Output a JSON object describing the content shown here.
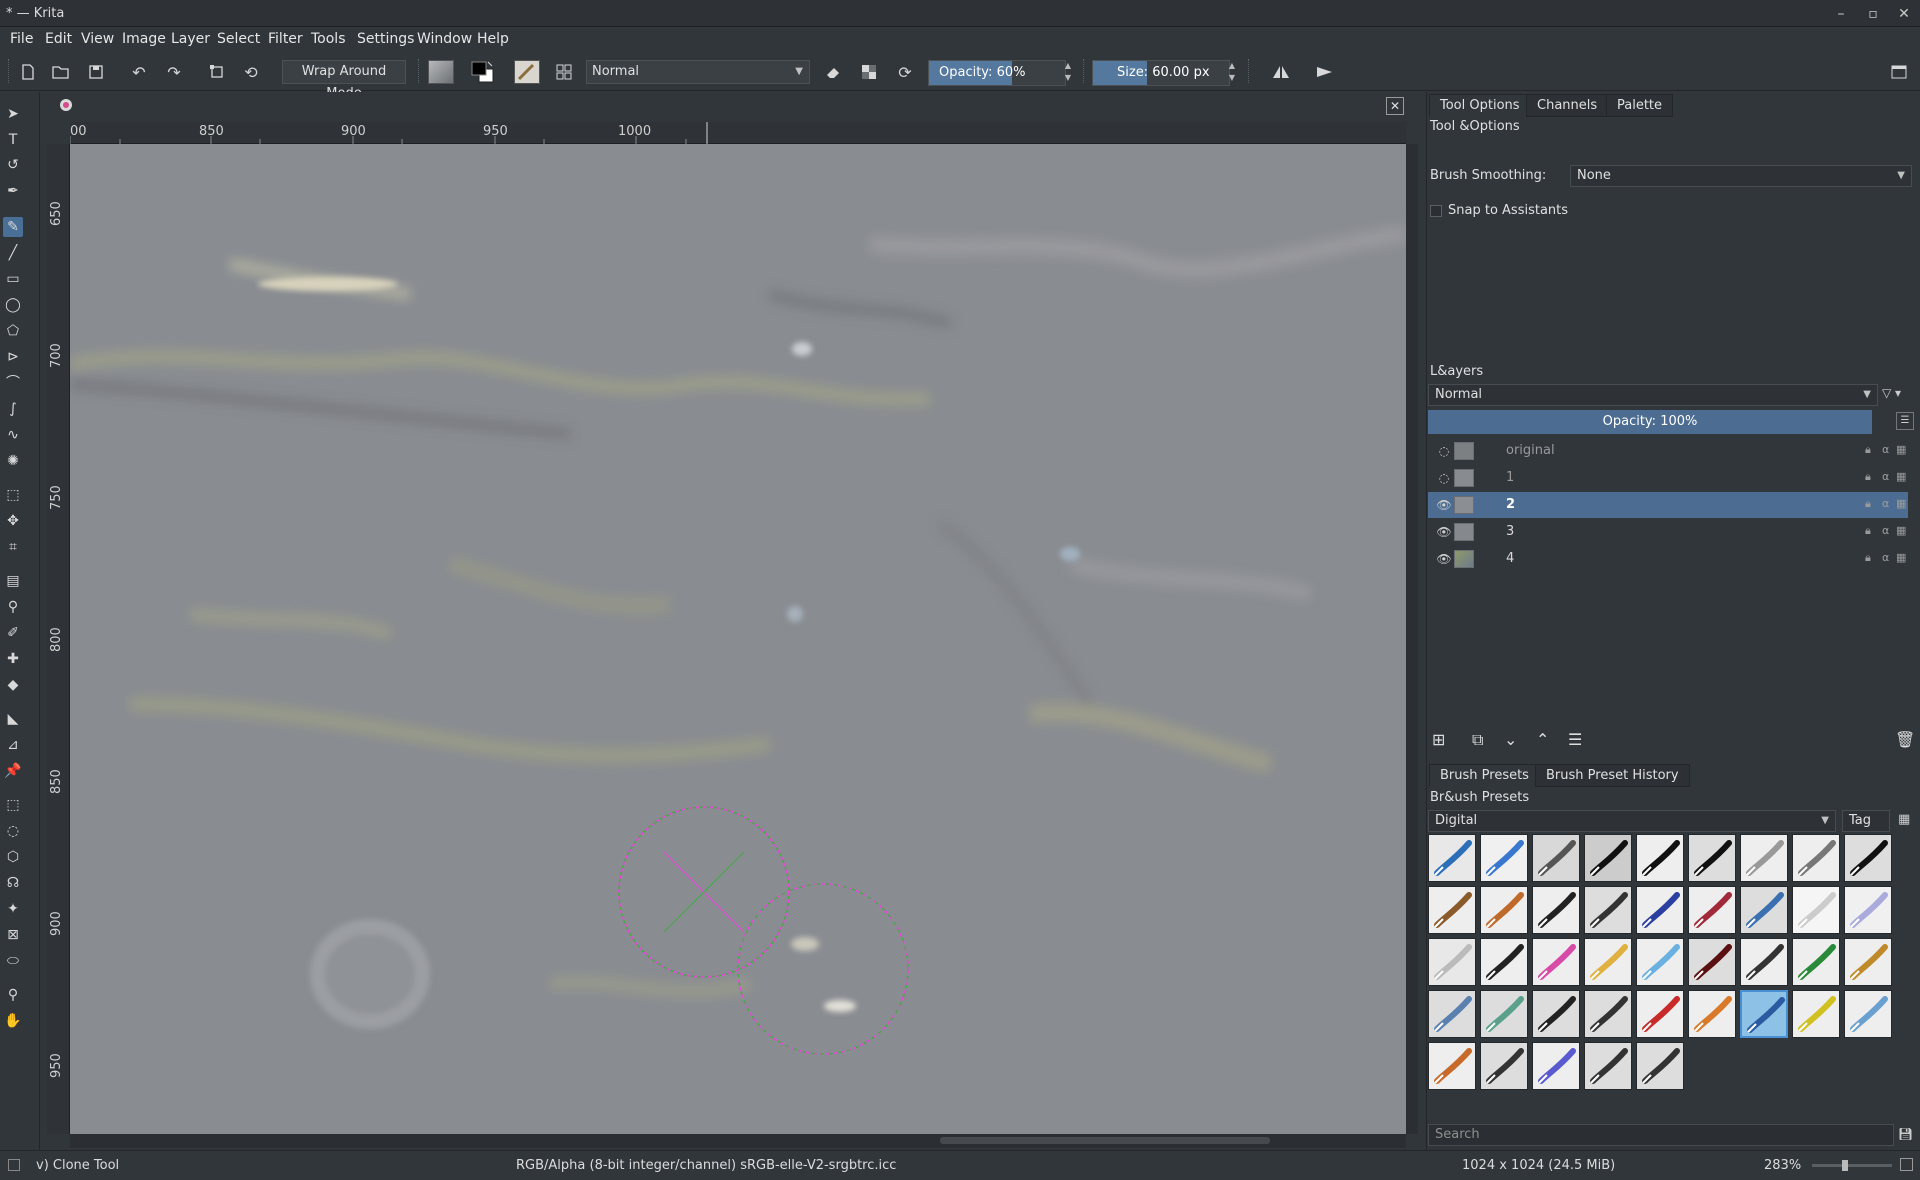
{
  "window": {
    "title": "* — Krita",
    "minimize": "–",
    "maximize": "▫",
    "close": "✕"
  },
  "menu": [
    "File",
    "Edit",
    "View",
    "Image",
    "Layer",
    "Select",
    "Filter",
    "Tools",
    "Settings",
    "Window",
    "Help"
  ],
  "toolbar": {
    "wrap_around_mode": "Wrap Around Mode",
    "blend_mode": "Normal",
    "opacity_label": "Opacity:",
    "opacity_value": "60%",
    "opacity_fraction": 0.6,
    "size_label": "Size:",
    "size_value": "60.00 px"
  },
  "canvas": {
    "close_label": "✕",
    "ruler_h": [
      "00",
      "850",
      "900",
      "950",
      "1000"
    ],
    "ruler_v": [
      "650",
      "700",
      "750",
      "800",
      "850",
      "900",
      "950"
    ]
  },
  "dock": {
    "top_tabs": [
      "Tool Options",
      "Channels",
      "Palette"
    ],
    "tool_options_title": "Tool &Options",
    "brush_smoothing_label": "Brush Smoothing:",
    "brush_smoothing_value": "None",
    "snap_label": "Snap to Assistants",
    "layers_title": "L&ayers",
    "layers_blend": "Normal",
    "layers_opacity": "Opacity:  100%",
    "layers": [
      {
        "name": "original",
        "visible": false,
        "active": false
      },
      {
        "name": "1",
        "visible": false,
        "active": false
      },
      {
        "name": "2",
        "visible": true,
        "active": true
      },
      {
        "name": "3",
        "visible": true,
        "active": false
      },
      {
        "name": "4",
        "visible": true,
        "active": false
      }
    ],
    "preset_tabs": [
      "Brush Presets",
      "Brush Preset History"
    ],
    "presets_title": "Br&ush Presets",
    "presets_tag_value": "Digital",
    "presets_tag_button": "Tag",
    "search_placeholder": "Search"
  },
  "status": {
    "tool": "v) Clone Tool",
    "color_model": "RGB/Alpha (8-bit integer/channel)  sRGB-elle-V2-srgbtrc.icc",
    "image_size": "1024 x 1024 (24.5 MiB)",
    "zoom": "283%"
  },
  "colors": {
    "accent": "#54789e",
    "layer_selected": "#4c6d91",
    "canvas": "#8a8d92"
  }
}
